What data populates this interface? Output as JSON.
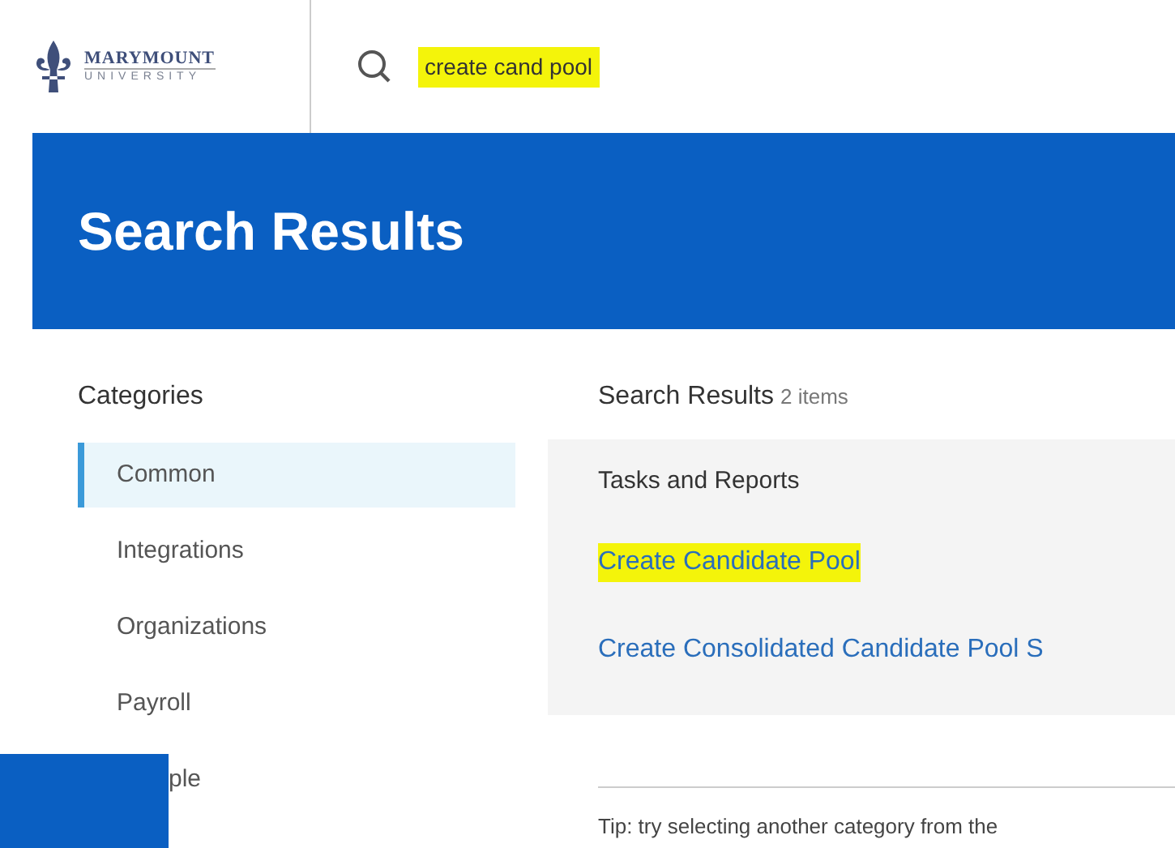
{
  "header": {
    "logo": {
      "name": "MARYMOUNT",
      "subtitle": "UNIVERSITY"
    },
    "search": {
      "value": "create cand pool",
      "highlighted": true
    }
  },
  "banner": {
    "title": "Search Results"
  },
  "categories": {
    "heading": "Categories",
    "items": [
      {
        "label": "Common",
        "selected": true
      },
      {
        "label": "Integrations",
        "selected": false
      },
      {
        "label": "Organizations",
        "selected": false
      },
      {
        "label": "Payroll",
        "selected": false
      },
      {
        "label": "ple",
        "selected": false,
        "covered": true
      }
    ]
  },
  "results": {
    "heading": "Search Results",
    "count": "2 items",
    "group": "Tasks and Reports",
    "items": [
      {
        "label": "Create Candidate Pool",
        "highlighted": true
      },
      {
        "label": "Create Consolidated Candidate Pool S",
        "highlighted": false
      }
    ],
    "tip": "Tip: try selecting another category from the"
  }
}
